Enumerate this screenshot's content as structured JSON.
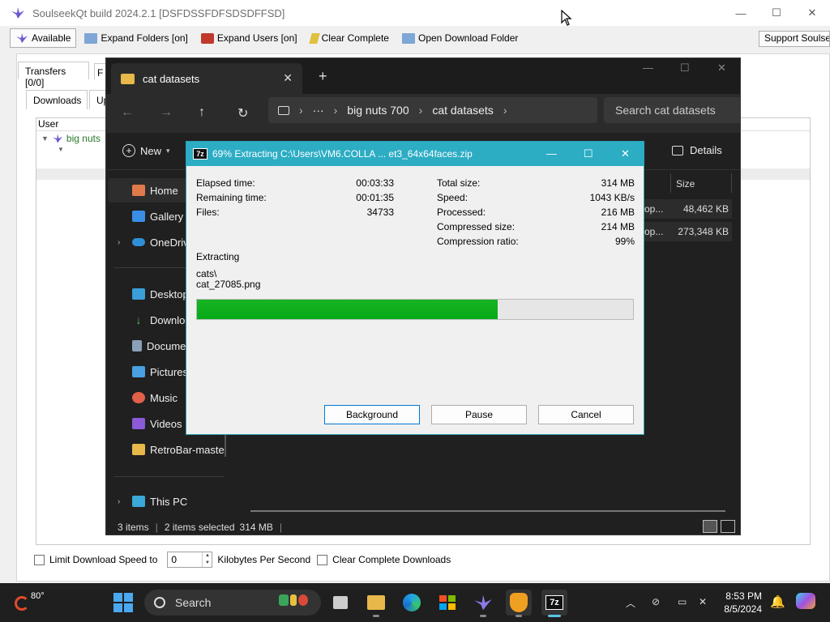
{
  "soulseek": {
    "title": "SoulseekQt build 2024.2.1 [DSFDSSFDFSDSDFFSD]",
    "toolbar": {
      "available": "Available",
      "expand_folders": "Expand Folders [on]",
      "expand_users": "Expand Users [on]",
      "clear_complete": "Clear Complete",
      "open_download_folder": "Open Download Folder",
      "support": "Support Soulseek"
    },
    "tabs": {
      "transfers": "Transfers [0/0]",
      "transfers_next": "F",
      "downloads": "Downloads",
      "uploads": "Up"
    },
    "list": {
      "header_user": "User",
      "user_row": "big nuts"
    },
    "bottom": {
      "limit_label": "Limit Download Speed to",
      "limit_value": "0",
      "units": "Kilobytes Per Second",
      "clear_complete_downloads": "Clear Complete Downloads"
    }
  },
  "explorer": {
    "tab_title": "cat datasets",
    "breadcrumb": [
      "big nuts 700",
      "cat datasets"
    ],
    "search_placeholder": "Search cat datasets",
    "new_label": "New",
    "details_label": "Details",
    "nav": {
      "home": "Home",
      "gallery": "Gallery",
      "onedrive": "OneDrive",
      "desktop": "Desktop",
      "downloads": "Downloads",
      "documents": "Documents",
      "pictures": "Pictures",
      "music": "Music",
      "videos": "Videos",
      "retrobar": "RetroBar-master",
      "this_pc": "This PC"
    },
    "columns": {
      "size": "Size"
    },
    "files": [
      {
        "type": "op...",
        "size": "48,462 KB"
      },
      {
        "type": "op...",
        "size": "273,348 KB"
      }
    ],
    "status": {
      "items": "3 items",
      "selected": "2 items selected",
      "selected_size": "314 MB"
    }
  },
  "zip": {
    "logo": "7z",
    "title": "69% Extracting C:\\Users\\VM6.COLLA ... et3_64x64faces.zip",
    "percent": 69,
    "left": {
      "elapsed_label": "Elapsed time:",
      "elapsed": "00:03:33",
      "remaining_label": "Remaining time:",
      "remaining": "00:01:35",
      "files_label": "Files:",
      "files": "34733"
    },
    "right": {
      "total_label": "Total size:",
      "total": "314 MB",
      "speed_label": "Speed:",
      "speed": "1043 KB/s",
      "processed_label": "Processed:",
      "processed": "216 MB",
      "compressed_label": "Compressed size:",
      "compressed": "214 MB",
      "ratio_label": "Compression ratio:",
      "ratio": "99%"
    },
    "status_label": "Extracting",
    "current_folder": "cats\\",
    "current_file": "cat_27085.png",
    "buttons": {
      "background": "Background",
      "pause": "Pause",
      "cancel": "Cancel"
    }
  },
  "taskbar": {
    "temperature": "80°",
    "search": "Search",
    "time": "8:53 PM",
    "date": "8/5/2024"
  }
}
